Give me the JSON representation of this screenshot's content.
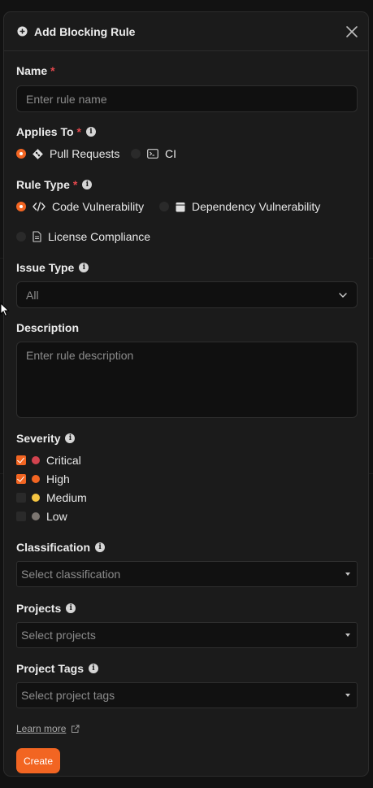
{
  "modal": {
    "title": "Add Blocking Rule",
    "accent_color": "#f26522"
  },
  "name": {
    "label": "Name",
    "required_mark": "*",
    "placeholder": "Enter rule name",
    "value": ""
  },
  "applies_to": {
    "label": "Applies To",
    "required_mark": "*",
    "options": [
      {
        "label": "Pull Requests",
        "selected": true,
        "icon": "git-pr-icon"
      },
      {
        "label": "CI",
        "selected": false,
        "icon": "terminal-icon"
      }
    ]
  },
  "rule_type": {
    "label": "Rule Type",
    "required_mark": "*",
    "options": [
      {
        "label": "Code Vulnerability",
        "selected": true,
        "icon": "code-icon"
      },
      {
        "label": "Dependency Vulnerability",
        "selected": false,
        "icon": "package-icon"
      },
      {
        "label": "License Compliance",
        "selected": false,
        "icon": "document-icon"
      }
    ]
  },
  "issue_type": {
    "label": "Issue Type",
    "selected": "All"
  },
  "description": {
    "label": "Description",
    "placeholder": "Enter rule description",
    "value": ""
  },
  "severity": {
    "label": "Severity",
    "options": [
      {
        "label": "Critical",
        "checked": true,
        "color": "#d2434f"
      },
      {
        "label": "High",
        "checked": true,
        "color": "#f26522"
      },
      {
        "label": "Medium",
        "checked": false,
        "color": "#f5c542"
      },
      {
        "label": "Low",
        "checked": false,
        "color": "#7c7671"
      }
    ]
  },
  "classification": {
    "label": "Classification",
    "placeholder": "Select classification"
  },
  "projects": {
    "label": "Projects",
    "placeholder": "Select projects"
  },
  "project_tags": {
    "label": "Project Tags",
    "placeholder": "Select project tags"
  },
  "footer": {
    "learn_more": "Learn more",
    "create_label": "Create"
  }
}
